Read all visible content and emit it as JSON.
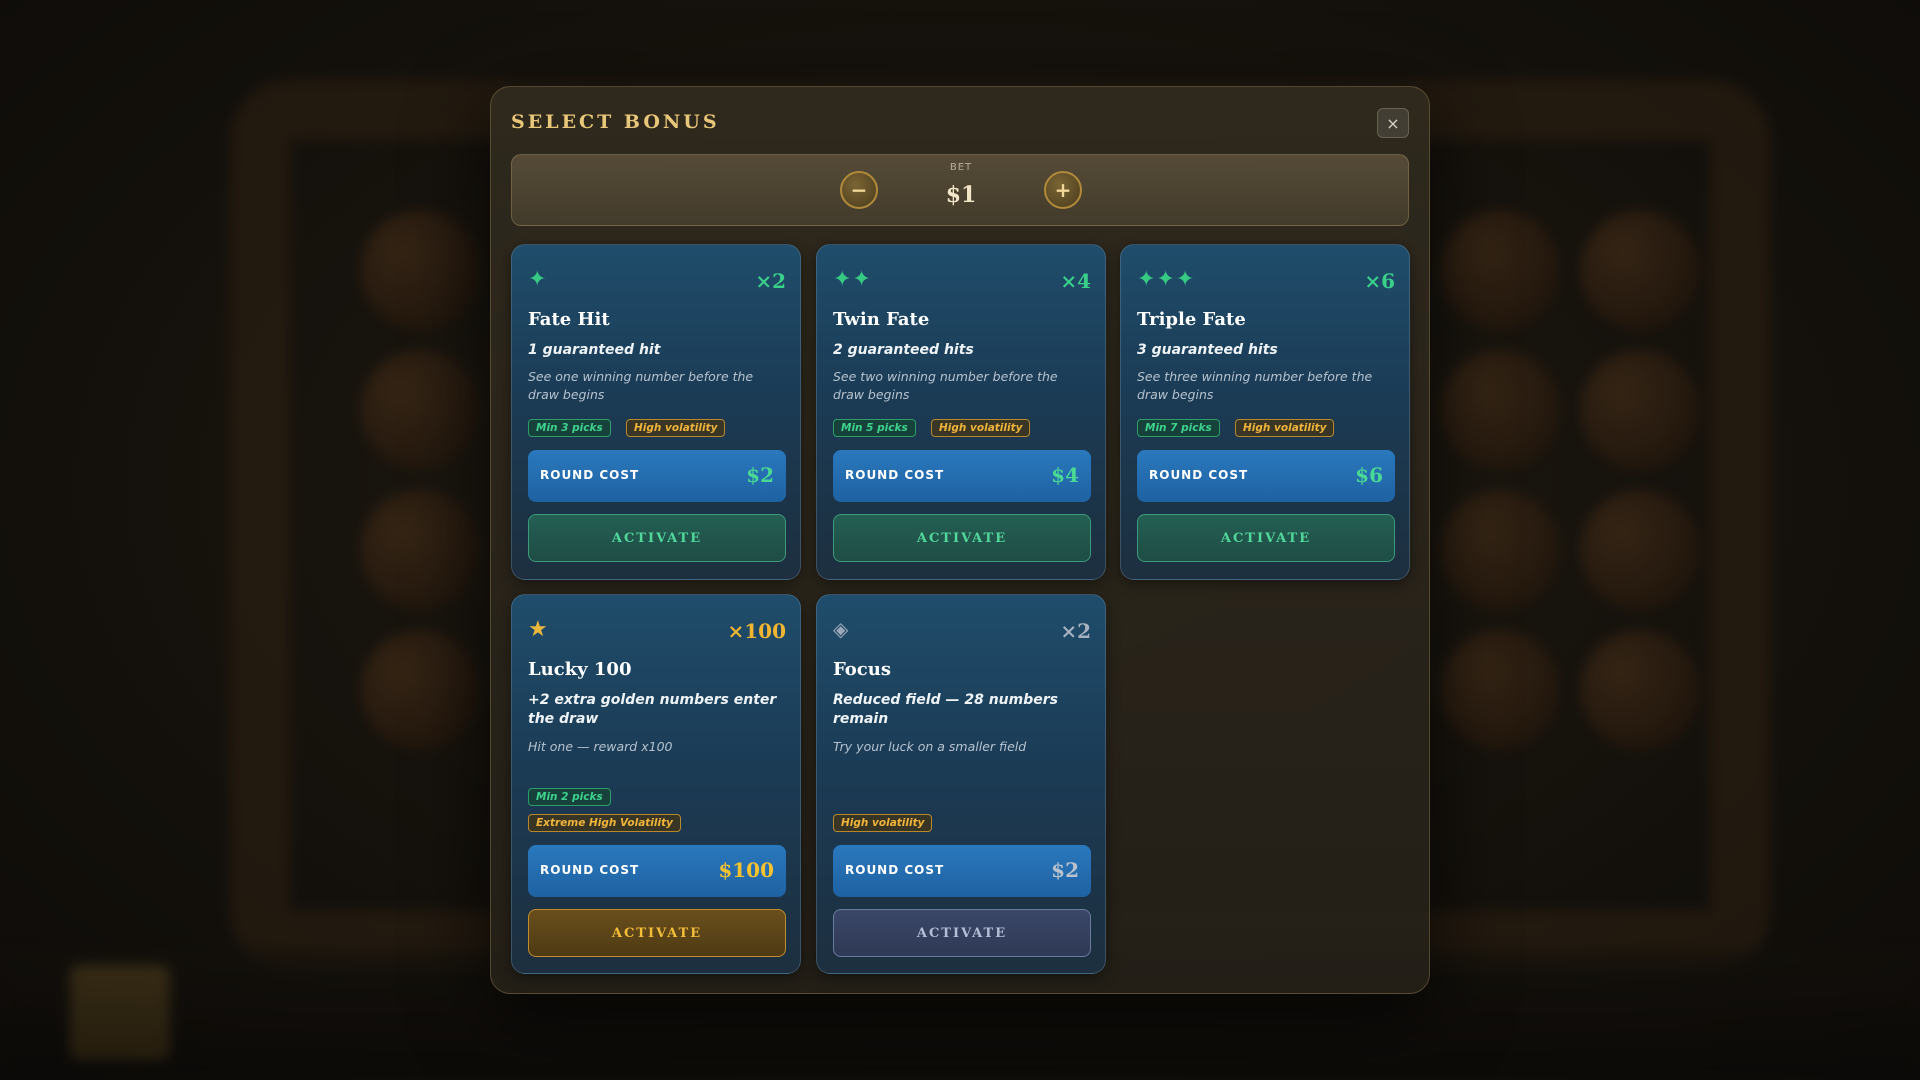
{
  "modal": {
    "title": "SELECT BONUS",
    "close_icon": "×"
  },
  "bet": {
    "label": "BET",
    "value": "$1",
    "minus_label": "−",
    "plus_label": "+"
  },
  "cards": [
    {
      "icon": "✦",
      "multiplier": "×2",
      "title": "Fate Hit",
      "subtitle": "1 guaranteed hit",
      "description": "See one winning number before the draw begins",
      "tags": [
        "Min 3 picks",
        "High volatility"
      ],
      "cost_label": "ROUND COST",
      "cost_value": "$2",
      "activate_label": "ACTIVATE"
    },
    {
      "icon": "✦✦",
      "multiplier": "×4",
      "title": "Twin Fate",
      "subtitle": "2 guaranteed hits",
      "description": "See two winning number before the draw begins",
      "tags": [
        "Min 5 picks",
        "High volatility"
      ],
      "cost_label": "ROUND COST",
      "cost_value": "$4",
      "activate_label": "ACTIVATE"
    },
    {
      "icon": "✦✦✦",
      "multiplier": "×6",
      "title": "Triple Fate",
      "subtitle": "3 guaranteed hits",
      "description": "See three winning number before the draw begins",
      "tags": [
        "Min 7 picks",
        "High volatility"
      ],
      "cost_label": "ROUND COST",
      "cost_value": "$6",
      "activate_label": "ACTIVATE"
    },
    {
      "icon": "★",
      "multiplier": "×100",
      "title": "Lucky 100",
      "subtitle": "+2 extra golden numbers enter the draw",
      "description": "Hit one — reward x100",
      "tags": [
        "Min 2 picks",
        "Extreme High Volatility"
      ],
      "cost_label": "ROUND COST",
      "cost_value": "$100",
      "activate_label": "ACTIVATE"
    },
    {
      "icon": "◈",
      "multiplier": "×2",
      "title": "Focus",
      "subtitle": "Reduced field — 28 numbers remain",
      "description": "Try your luck on a smaller field",
      "tags": [
        "High volatility"
      ],
      "cost_label": "ROUND COST",
      "cost_value": "$2",
      "activate_label": "ACTIVATE"
    }
  ],
  "colors": {
    "accent_green": "#3ad08a",
    "accent_gold": "#f1b531",
    "card_blue": "#1f4d6b",
    "cost_blue": "#2a78bd",
    "title_gold": "#e9c77a"
  },
  "icons": {
    "fate_hit": "sparkle-icon",
    "twin_fate": "double-sparkle-icon",
    "triple_fate": "triple-sparkle-icon",
    "lucky_100": "star-icon",
    "focus": "diamond-target-icon",
    "close": "close-icon"
  }
}
